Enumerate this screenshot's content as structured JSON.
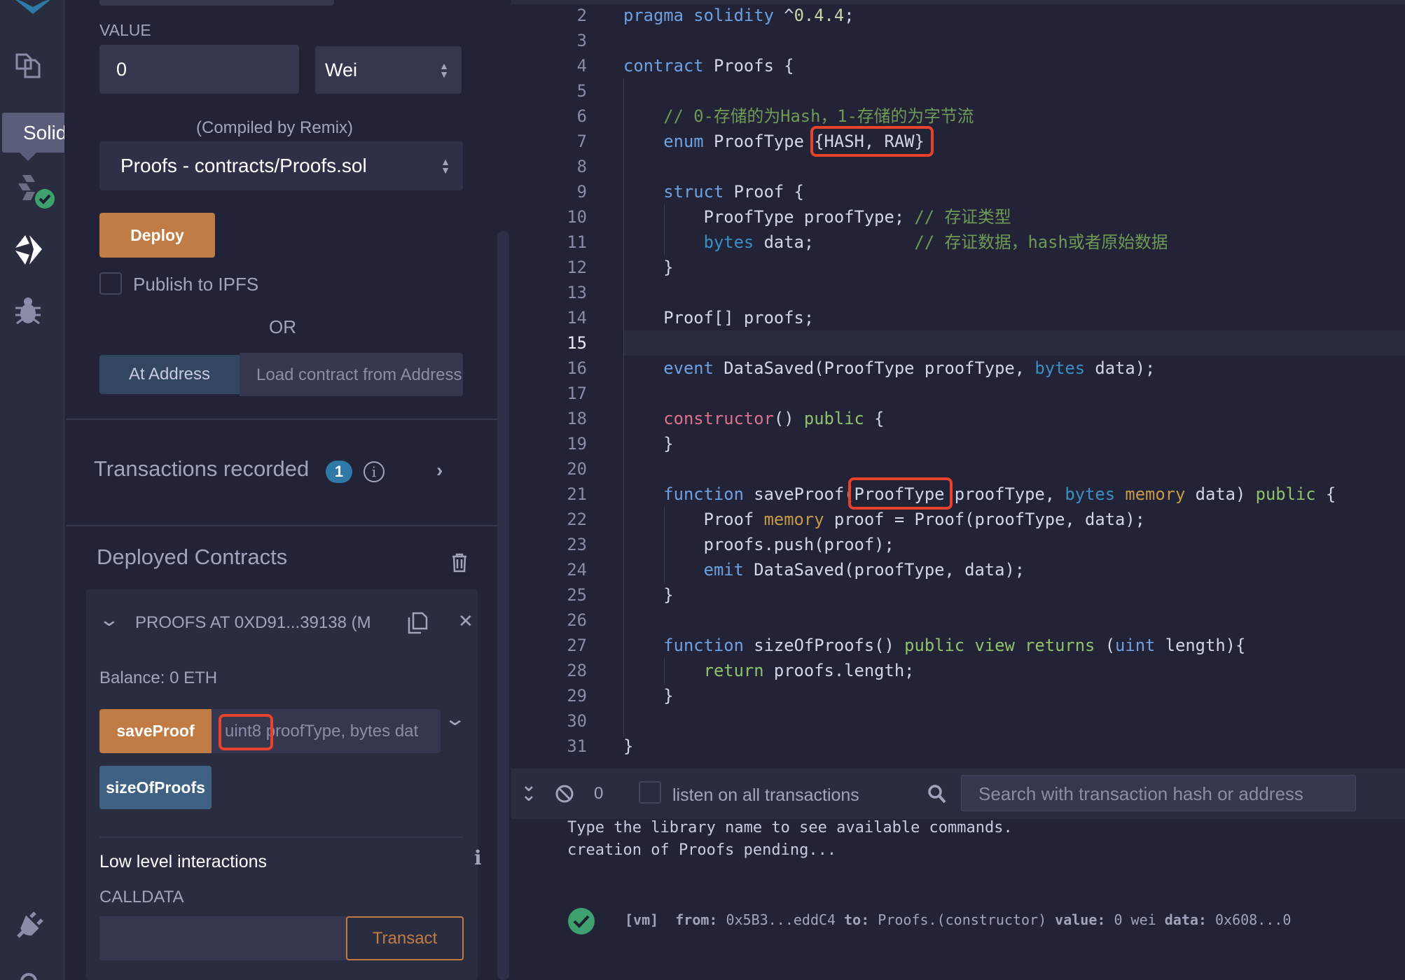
{
  "sidebar_icons": [
    {
      "name": "remix-logo-icon"
    },
    {
      "name": "file-explorer-icon"
    },
    {
      "name": "solidity-compiler-icon"
    },
    {
      "name": "deploy-run-icon"
    },
    {
      "name": "debugger-icon"
    },
    {
      "name": "plugin-manager-icon"
    },
    {
      "name": "settings-icon"
    }
  ],
  "tooltip": "Solidity compiler",
  "panel": {
    "value_label": "VALUE",
    "value": "0",
    "unit": "Wei",
    "contract_hint": "(Compiled by Remix)",
    "contract": "Proofs - contracts/Proofs.sol",
    "deploy": "Deploy",
    "publish_ipfs": "Publish to IPFS",
    "publish_ipfs_checked": false,
    "or": "OR",
    "at_address": "At Address",
    "load_placeholder": "Load contract from Address",
    "transactions_recorded": "Transactions recorded",
    "transactions_count": "1",
    "deployed_contracts": "Deployed Contracts",
    "instance": {
      "title": "PROOFS AT 0XD91...39138 (M",
      "balance": "Balance: 0 ETH",
      "functions": [
        {
          "label": "saveProof",
          "kind": "transact",
          "param_highlight": "uint8",
          "params": " proofType, bytes dat"
        },
        {
          "label": "sizeOfProofs",
          "kind": "call"
        }
      ],
      "low_level": "Low level interactions",
      "calldata_label": "CALLDATA",
      "calldata": "",
      "transact": "Transact"
    }
  },
  "editor": {
    "current_line": "15",
    "lines": [
      {
        "n": "2",
        "tokens": [
          {
            "t": "pragma solidity",
            "c": "kw"
          },
          {
            "t": " ^",
            "c": "tx"
          },
          {
            "t": "0.4.4",
            "c": "num"
          },
          {
            "t": ";",
            "c": "tx"
          }
        ]
      },
      {
        "n": "3",
        "tokens": []
      },
      {
        "n": "4",
        "tokens": [
          {
            "t": "contract",
            "c": "kw"
          },
          {
            "t": " Proofs {",
            "c": "tx"
          }
        ]
      },
      {
        "n": "5",
        "tokens": []
      },
      {
        "n": "6",
        "tokens": [
          {
            "t": "    // 0-存储的为Hash，1-存储的为字节流",
            "c": "cm"
          }
        ]
      },
      {
        "n": "7",
        "tokens": [
          {
            "t": "    enum",
            "c": "kw"
          },
          {
            "t": " ProofType {HASH, RAW}",
            "c": "tx"
          }
        ]
      },
      {
        "n": "8",
        "tokens": []
      },
      {
        "n": "9",
        "tokens": [
          {
            "t": "    struct",
            "c": "kw"
          },
          {
            "t": " Proof {",
            "c": "tx"
          }
        ]
      },
      {
        "n": "10",
        "tokens": [
          {
            "t": "        ProofType proofType; ",
            "c": "tx"
          },
          {
            "t": "// 存证类型",
            "c": "cm"
          }
        ]
      },
      {
        "n": "11",
        "tokens": [
          {
            "t": "        bytes",
            "c": "ty"
          },
          {
            "t": " data;          ",
            "c": "tx"
          },
          {
            "t": "// 存证数据，hash或者原始数据",
            "c": "cm"
          }
        ]
      },
      {
        "n": "12",
        "tokens": [
          {
            "t": "    }",
            "c": "tx"
          }
        ]
      },
      {
        "n": "13",
        "tokens": []
      },
      {
        "n": "14",
        "tokens": [
          {
            "t": "    Proof[] proofs;",
            "c": "tx"
          }
        ]
      },
      {
        "n": "15",
        "tokens": []
      },
      {
        "n": "16",
        "tokens": [
          {
            "t": "    event",
            "c": "kw"
          },
          {
            "t": " DataSaved(ProofType proofType, ",
            "c": "tx"
          },
          {
            "t": "bytes",
            "c": "ty"
          },
          {
            "t": " data);",
            "c": "tx"
          }
        ]
      },
      {
        "n": "17",
        "tokens": []
      },
      {
        "n": "18",
        "tokens": [
          {
            "t": "    constructor",
            "c": "ctor"
          },
          {
            "t": "() ",
            "c": "tx"
          },
          {
            "t": "public",
            "c": "mod"
          },
          {
            "t": " {",
            "c": "tx"
          }
        ]
      },
      {
        "n": "19",
        "tokens": [
          {
            "t": "    }",
            "c": "tx"
          }
        ]
      },
      {
        "n": "20",
        "tokens": []
      },
      {
        "n": "21",
        "tokens": [
          {
            "t": "    function",
            "c": "kw"
          },
          {
            "t": " saveProof(ProofType proofType, ",
            "c": "tx"
          },
          {
            "t": "bytes",
            "c": "ty"
          },
          {
            "t": " ",
            "c": "tx"
          },
          {
            "t": "memory",
            "c": "mem"
          },
          {
            "t": " data) ",
            "c": "tx"
          },
          {
            "t": "public",
            "c": "mod"
          },
          {
            "t": " {",
            "c": "tx"
          }
        ]
      },
      {
        "n": "22",
        "tokens": [
          {
            "t": "        Proof ",
            "c": "tx"
          },
          {
            "t": "memory",
            "c": "mem"
          },
          {
            "t": " proof = Proof(proofType, data);",
            "c": "tx"
          }
        ]
      },
      {
        "n": "23",
        "tokens": [
          {
            "t": "        proofs.push(proof);",
            "c": "tx"
          }
        ]
      },
      {
        "n": "24",
        "tokens": [
          {
            "t": "        emit",
            "c": "kw"
          },
          {
            "t": " DataSaved(proofType, data);",
            "c": "tx"
          }
        ]
      },
      {
        "n": "25",
        "tokens": [
          {
            "t": "    }",
            "c": "tx"
          }
        ]
      },
      {
        "n": "26",
        "tokens": []
      },
      {
        "n": "27",
        "tokens": [
          {
            "t": "    function",
            "c": "kw"
          },
          {
            "t": " sizeOfProofs() ",
            "c": "tx"
          },
          {
            "t": "public view returns",
            "c": "mod"
          },
          {
            "t": " (",
            "c": "tx"
          },
          {
            "t": "uint",
            "c": "kw"
          },
          {
            "t": " length){",
            "c": "tx"
          }
        ]
      },
      {
        "n": "28",
        "tokens": [
          {
            "t": "        return",
            "c": "mod"
          },
          {
            "t": " proofs.length;",
            "c": "tx"
          }
        ]
      },
      {
        "n": "29",
        "tokens": [
          {
            "t": "    }",
            "c": "tx"
          }
        ]
      },
      {
        "n": "30",
        "tokens": []
      },
      {
        "n": "31",
        "tokens": [
          {
            "t": "}",
            "c": "tx"
          }
        ]
      }
    ]
  },
  "terminal": {
    "pending_count": "0",
    "listen_label": "listen on all transactions",
    "listen_checked": false,
    "search_placeholder": "Search with transaction hash or address",
    "lines": [
      "Type the library name to see available commands.",
      "creation of Proofs pending..."
    ],
    "tx": {
      "vm": "[vm]",
      "from_label": "from:",
      "from": "0x5B3...eddC4",
      "to_label": "to:",
      "to": "Proofs.(constructor)",
      "value_label": "value:",
      "value": "0 wei",
      "data_label": "data:",
      "data": "0x608...0"
    }
  },
  "colors": {
    "deploy": "#c17b45",
    "call": "#3f6183",
    "success": "#3ea06e",
    "highlight": "#e8412c",
    "badge": "#2f79a8"
  }
}
